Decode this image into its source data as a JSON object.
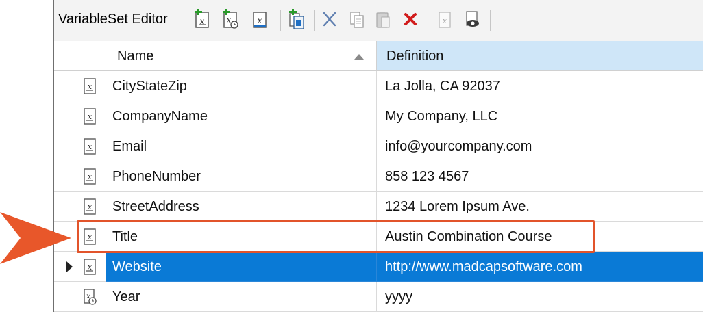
{
  "toolbar": {
    "title": "VariableSet Editor",
    "icons": [
      "add-variable-icon",
      "add-date-variable-icon",
      "edit-variable-icon",
      "import-icon",
      "cut-icon",
      "copy-icon",
      "paste-icon",
      "delete-icon",
      "edit-definition-icon",
      "preview-icon"
    ]
  },
  "grid": {
    "columns": {
      "name": "Name",
      "definition": "Definition"
    },
    "sorted_column": "Name",
    "rows": [
      {
        "name": "CityStateZip",
        "definition": "La Jolla, CA 92037",
        "icon": "variable-icon"
      },
      {
        "name": "CompanyName",
        "definition": "My Company, LLC",
        "icon": "variable-icon"
      },
      {
        "name": "Email",
        "definition": "info@yourcompany.com",
        "icon": "variable-icon"
      },
      {
        "name": "PhoneNumber",
        "definition": "858 123 4567",
        "icon": "variable-icon"
      },
      {
        "name": "StreetAddress",
        "definition": "1234 Lorem Ipsum Ave.",
        "icon": "variable-icon"
      },
      {
        "name": "Title",
        "definition": "Austin Combination Course",
        "icon": "variable-icon"
      },
      {
        "name": "Website",
        "definition": "http://www.madcapsoftware.com",
        "icon": "variable-icon"
      },
      {
        "name": "Year",
        "definition": "yyyy",
        "icon": "date-variable-icon"
      }
    ],
    "selected_row": "Website",
    "highlighted_row": "Title"
  },
  "colors": {
    "selection": "#0a7ad6",
    "highlight": "#e2542b",
    "definition_header": "#cfe6f8"
  }
}
